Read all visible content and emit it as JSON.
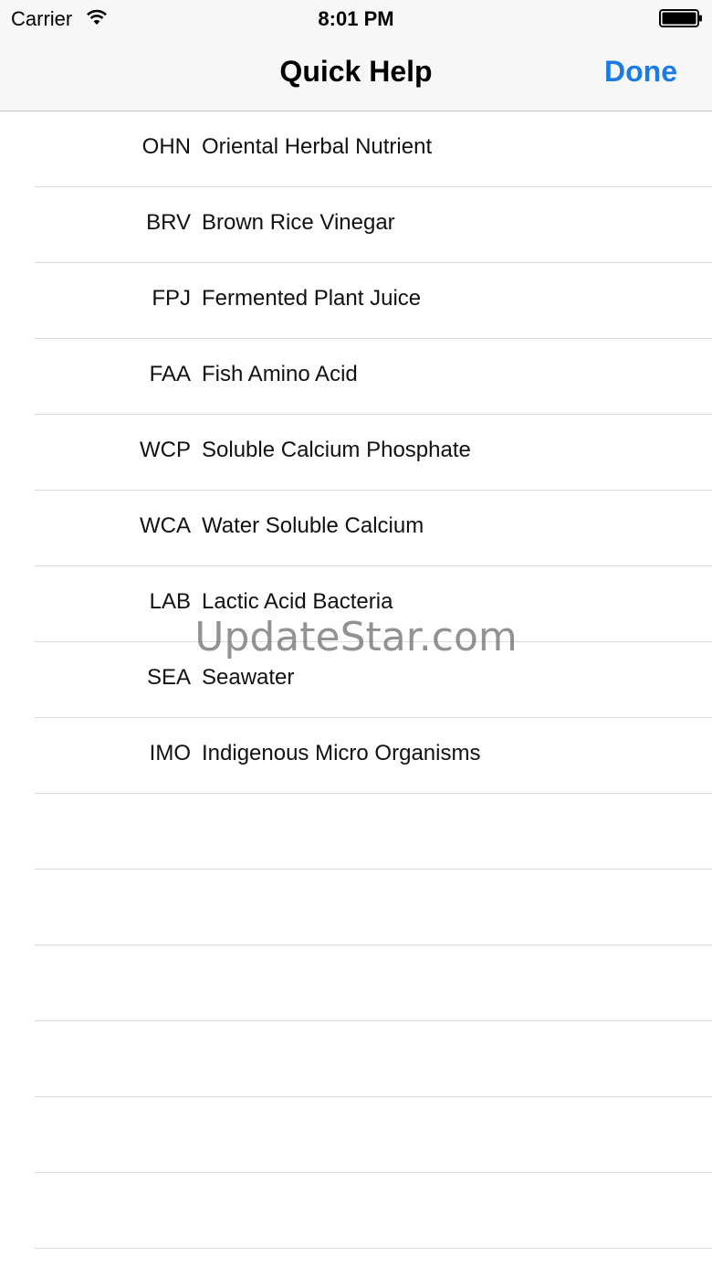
{
  "status_bar": {
    "carrier": "Carrier",
    "time": "8:01 PM",
    "icons": [
      "wifi-icon",
      "battery-icon"
    ]
  },
  "nav_bar": {
    "title": "Quick Help",
    "done_label": "Done",
    "accent_color": "#1a7ae6"
  },
  "glossary": [
    {
      "abbr": "OHN",
      "name": "Oriental Herbal Nutrient"
    },
    {
      "abbr": "BRV",
      "name": "Brown Rice Vinegar"
    },
    {
      "abbr": "FPJ",
      "name": "Fermented Plant Juice"
    },
    {
      "abbr": "FAA",
      "name": "Fish Amino Acid"
    },
    {
      "abbr": "WCP",
      "name": "Soluble Calcium Phosphate"
    },
    {
      "abbr": "WCA",
      "name": "Water Soluble Calcium"
    },
    {
      "abbr": "LAB",
      "name": "Lactic Acid Bacteria"
    },
    {
      "abbr": "SEA",
      "name": "Seawater"
    },
    {
      "abbr": "IMO",
      "name": "Indigenous Micro Organisms"
    }
  ],
  "watermark": "UpdateStar.com"
}
